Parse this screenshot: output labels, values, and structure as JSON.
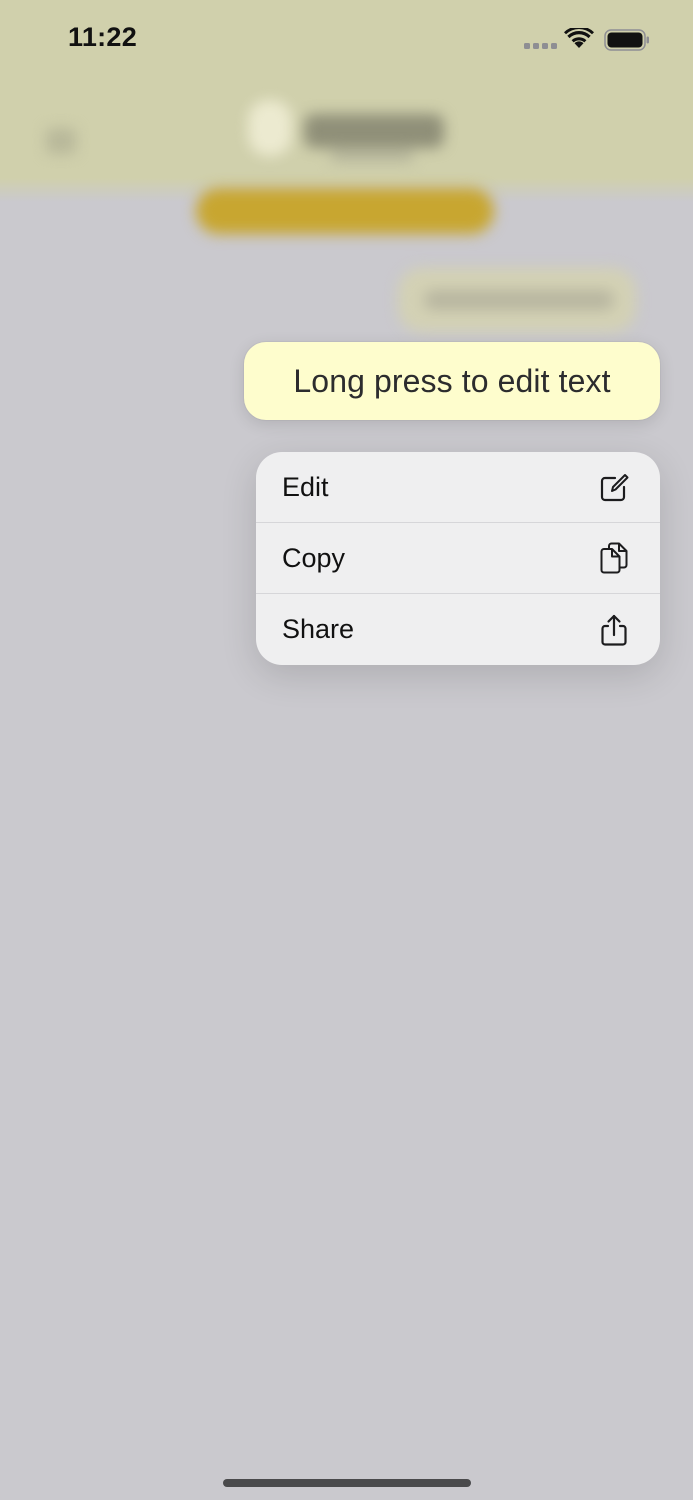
{
  "status_bar": {
    "time": "11:22"
  },
  "message": {
    "text": "Long press to edit text"
  },
  "context_menu": {
    "items": [
      {
        "label": "Edit",
        "icon": "square-and-pencil-icon"
      },
      {
        "label": "Copy",
        "icon": "doc-on-doc-icon"
      },
      {
        "label": "Share",
        "icon": "square-and-arrow-up-icon"
      }
    ]
  },
  "colors": {
    "top_band": "#d0d0ac",
    "background": "#cac9ce",
    "bubble": "#fefdcd",
    "menu": "#efeff0",
    "accent_blurred_pill": "#c8a630"
  }
}
